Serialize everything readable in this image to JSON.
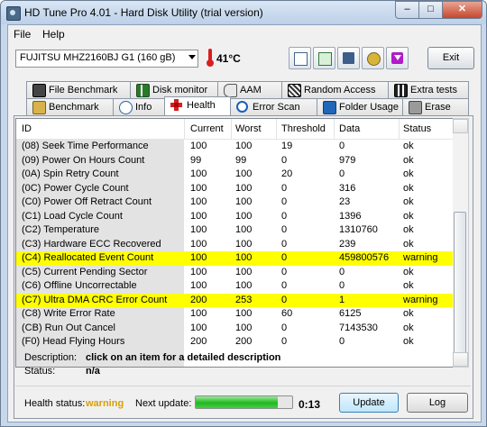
{
  "window": {
    "title": "HD Tune Pro 4.01 - Hard Disk Utility (trial version)",
    "min": "–",
    "max": "□",
    "close": "✕"
  },
  "menu": [
    {
      "label": "File"
    },
    {
      "label": "Help"
    }
  ],
  "toolbar": {
    "drive_label": "FUJITSU MHZ2160BJ G1     (160 gB)",
    "temperature": "41°C",
    "icons": [
      "copy-icon",
      "copy-info-icon",
      "save-icon",
      "options-icon",
      "download-icon"
    ],
    "exit_label": "Exit"
  },
  "tabs_row1": [
    {
      "label": "File Benchmark",
      "icon": "file-benchmark-icon"
    },
    {
      "label": "Disk monitor",
      "icon": "disk-monitor-icon"
    },
    {
      "label": "AAM",
      "icon": "speaker-icon"
    },
    {
      "label": "Random Access",
      "icon": "random-access-icon"
    },
    {
      "label": "Extra tests",
      "icon": "extra-tests-icon"
    }
  ],
  "tabs_row2": [
    {
      "label": "Benchmark",
      "icon": "benchmark-icon"
    },
    {
      "label": "Info",
      "icon": "info-icon"
    },
    {
      "label": "Health",
      "icon": "health-cross-icon",
      "active": true
    },
    {
      "label": "Error Scan",
      "icon": "magnifier-icon"
    },
    {
      "label": "Folder Usage",
      "icon": "folder-icon"
    },
    {
      "label": "Erase",
      "icon": "trash-icon"
    }
  ],
  "columns": [
    "ID",
    "Current",
    "Worst",
    "Threshold",
    "Data",
    "Status"
  ],
  "rows": [
    {
      "id": "(08) Seek Time Performance",
      "current": "100",
      "worst": "100",
      "threshold": "19",
      "data": "0",
      "status": "ok"
    },
    {
      "id": "(09) Power On Hours Count",
      "current": "99",
      "worst": "99",
      "threshold": "0",
      "data": "979",
      "status": "ok"
    },
    {
      "id": "(0A) Spin Retry Count",
      "current": "100",
      "worst": "100",
      "threshold": "20",
      "data": "0",
      "status": "ok"
    },
    {
      "id": "(0C) Power Cycle Count",
      "current": "100",
      "worst": "100",
      "threshold": "0",
      "data": "316",
      "status": "ok"
    },
    {
      "id": "(C0) Power Off Retract Count",
      "current": "100",
      "worst": "100",
      "threshold": "0",
      "data": "23",
      "status": "ok"
    },
    {
      "id": "(C1) Load Cycle Count",
      "current": "100",
      "worst": "100",
      "threshold": "0",
      "data": "1396",
      "status": "ok"
    },
    {
      "id": "(C2) Temperature",
      "current": "100",
      "worst": "100",
      "threshold": "0",
      "data": "1310760",
      "status": "ok"
    },
    {
      "id": "(C3) Hardware ECC Recovered",
      "current": "100",
      "worst": "100",
      "threshold": "0",
      "data": "239",
      "status": "ok"
    },
    {
      "id": "(C4) Reallocated Event Count",
      "current": "100",
      "worst": "100",
      "threshold": "0",
      "data": "459800576",
      "status": "warning",
      "highlight": true
    },
    {
      "id": "(C5) Current Pending Sector",
      "current": "100",
      "worst": "100",
      "threshold": "0",
      "data": "0",
      "status": "ok"
    },
    {
      "id": "(C6) Offline Uncorrectable",
      "current": "100",
      "worst": "100",
      "threshold": "0",
      "data": "0",
      "status": "ok"
    },
    {
      "id": "(C7) Ultra DMA CRC Error Count",
      "current": "200",
      "worst": "253",
      "threshold": "0",
      "data": "1",
      "status": "warning",
      "highlight": true
    },
    {
      "id": "(C8) Write Error Rate",
      "current": "100",
      "worst": "100",
      "threshold": "60",
      "data": "6125",
      "status": "ok"
    },
    {
      "id": "(CB) Run Out Cancel",
      "current": "100",
      "worst": "100",
      "threshold": "0",
      "data": "7143530",
      "status": "ok"
    },
    {
      "id": "(F0) Head Flying Hours",
      "current": "200",
      "worst": "200",
      "threshold": "0",
      "data": "0",
      "status": "ok"
    }
  ],
  "description": {
    "label": "Description:",
    "value": "click on an item for a detailed description"
  },
  "status": {
    "label": "Status:",
    "value": "n/a"
  },
  "footer": {
    "health_label": "Health status:",
    "health_value": "warning",
    "next_update_label": "Next update:",
    "progress_fraction": 0.85,
    "countdown": "0:13",
    "update_label": "Update",
    "log_label": "Log"
  },
  "colors": {
    "highlight": "#ffff00",
    "warning_text": "#d8a000",
    "progress": "#1fb91f"
  }
}
